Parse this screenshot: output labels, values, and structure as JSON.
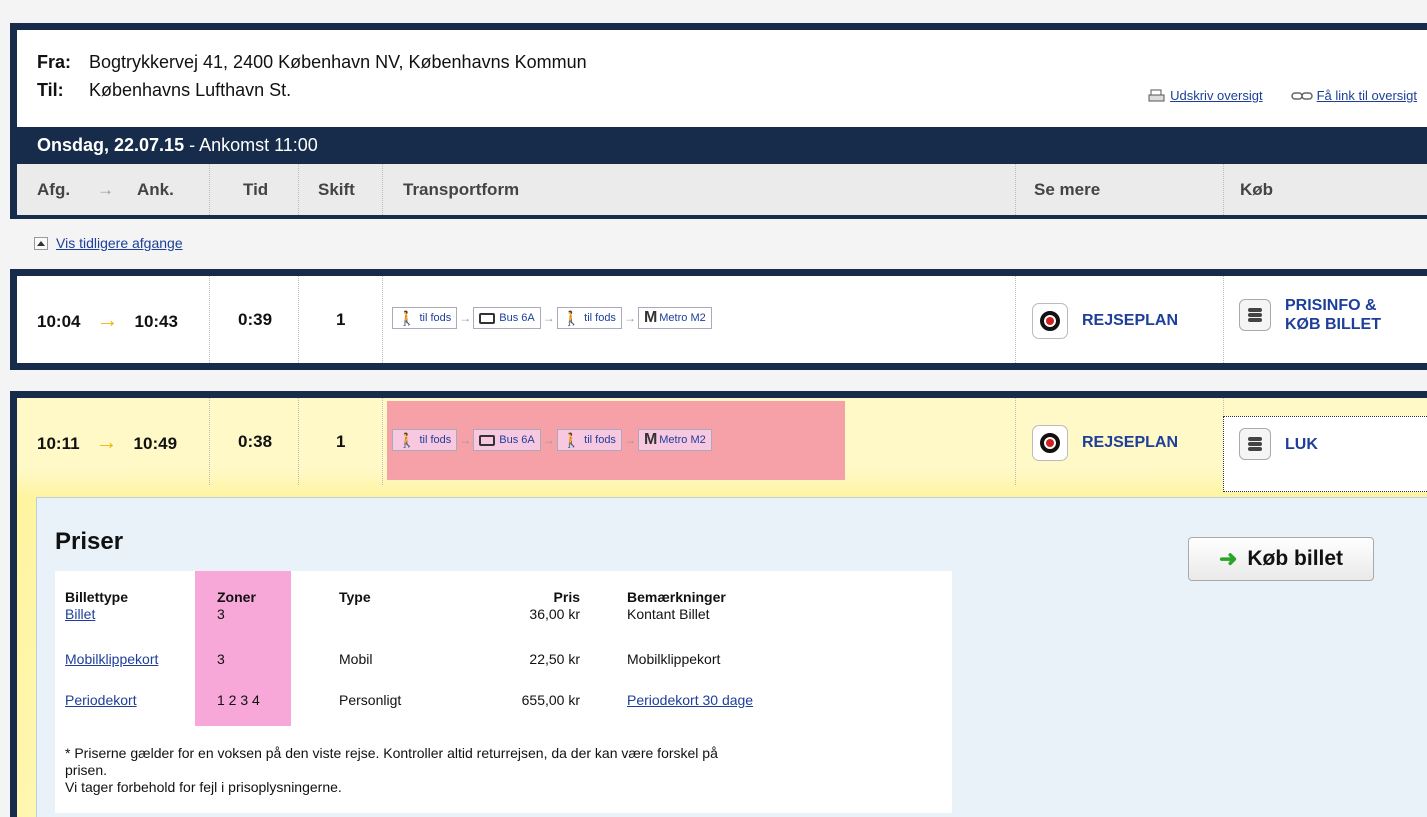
{
  "route": {
    "from_label": "Fra:",
    "from_value": "Bogtrykkervej 41, 2400 København NV, Københavns Kommun",
    "to_label": "Til:",
    "to_value": "Københavns Lufthavn St.",
    "print_link": "Udskriv oversigt",
    "link_link": "Få link til oversigt"
  },
  "date": {
    "day": "Onsdag, 22.07.15",
    "arrival": " - Ankomst 11:00"
  },
  "columns": {
    "dep": "Afg.",
    "arrow": "→",
    "arr": "Ank.",
    "time": "Tid",
    "changes": "Skift",
    "transport": "Transportform",
    "more": "Se mere",
    "buy": "Køb"
  },
  "earlier_link": "Vis tidligere afgange",
  "trips": [
    {
      "dep": "10:04",
      "arr": "10:43",
      "duration": "0:39",
      "changes": "1",
      "segments": [
        "til fods",
        "Bus 6A",
        "til fods",
        "Metro M2"
      ],
      "plan": "REJSEPLAN",
      "buy_line1": "PRISINFO &",
      "buy_line2": "KØB BILLET"
    },
    {
      "dep": "10:11",
      "arr": "10:49",
      "duration": "0:38",
      "changes": "1",
      "segments": [
        "til fods",
        "Bus 6A",
        "til fods",
        "Metro M2"
      ],
      "plan": "REJSEPLAN",
      "buy_line1": "LUK"
    }
  ],
  "prices": {
    "title": "Priser",
    "buy_button": "Køb billet",
    "headers": {
      "type_ticket": "Billettype",
      "zones": "Zoner",
      "type": "Type",
      "price": "Pris",
      "remarks": "Bemærkninger"
    },
    "rows": [
      {
        "ticket": "Billet",
        "zones": "3",
        "type": "",
        "price": "36,00 kr",
        "remark": "Kontant Billet"
      },
      {
        "ticket": "Mobilklippekort",
        "zones": "3",
        "type": "Mobil",
        "price": "22,50 kr",
        "remark": "Mobilklippekort"
      },
      {
        "ticket": "Periodekort",
        "zones": "1 2 3 4",
        "type": "Personligt",
        "price": "655,00 kr",
        "remark": "Periodekort 30 dage"
      }
    ],
    "note_line1": "* Priserne gælder for en voksen på den viste rejse. Kontroller altid returrejsen, da der kan være forskel på",
    "note_line2": "prisen.",
    "note_line3": "Vi tager forbehold for fejl i prisoplysningerne."
  },
  "colors": {
    "navy": "#162c4a",
    "link": "#1d3f9a",
    "highlight_pink": "#f6a0a8",
    "zone_pink": "#f7a8d8",
    "selected_yellow": "#fff9c8"
  }
}
